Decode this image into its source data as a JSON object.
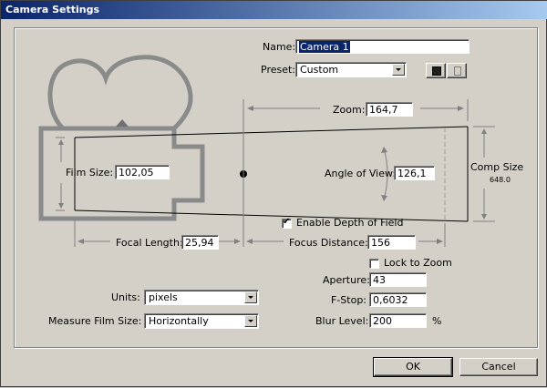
{
  "window": {
    "title": "Camera Settings"
  },
  "name": {
    "label": "Name:",
    "value": "Camera 1"
  },
  "preset": {
    "label": "Preset:",
    "value": "Custom"
  },
  "zoom": {
    "label": "Zoom:",
    "value": "164,7"
  },
  "film_size": {
    "label": "Film Size:",
    "value": "102,05"
  },
  "angle_of_view": {
    "label": "Angle of View:",
    "value": "126,1"
  },
  "comp_size": {
    "label": "Comp Size",
    "value": "648.0"
  },
  "enable_dof": {
    "label": "Enable Depth of Field",
    "checked": true
  },
  "focal_length": {
    "label": "Focal Length:",
    "value": "25,94"
  },
  "focus_distance": {
    "label": "Focus Distance:",
    "value": "156"
  },
  "lock_to_zoom": {
    "label": "Lock to Zoom",
    "checked": false
  },
  "aperture": {
    "label": "Aperture:",
    "value": "43"
  },
  "f_stop": {
    "label": "F-Stop:",
    "value": "0,6032"
  },
  "blur_level": {
    "label": "Blur Level:",
    "value": "200",
    "unit": "%"
  },
  "units": {
    "label": "Units:",
    "value": "pixels"
  },
  "measure_film_size": {
    "label": "Measure Film Size:",
    "value": "Horizontally"
  },
  "buttons": {
    "ok": "OK",
    "cancel": "Cancel"
  }
}
